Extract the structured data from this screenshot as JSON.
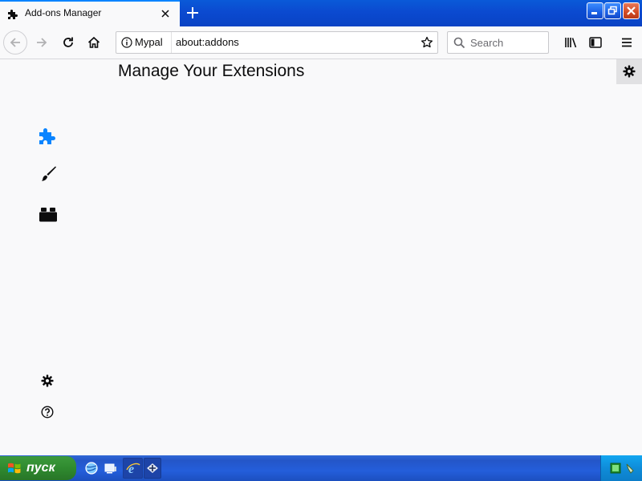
{
  "window": {
    "tab": {
      "title": "Add-ons Manager",
      "icon": "puzzle-icon"
    },
    "controls": [
      "minimize-icon",
      "restore-icon",
      "close-icon"
    ]
  },
  "navbar": {
    "identity_label": "Mypal",
    "url": "about:addons",
    "search_placeholder": "Search"
  },
  "content": {
    "heading": "Manage Your Extensions",
    "categories": [
      {
        "name": "extensions",
        "icon": "puzzle-icon",
        "color": "#0a84ff"
      },
      {
        "name": "themes",
        "icon": "brush-icon",
        "color": "#0c0c0d"
      },
      {
        "name": "plugins",
        "icon": "plugin-icon",
        "color": "#0c0c0d"
      }
    ],
    "footer": [
      "gear-icon",
      "help-icon"
    ]
  },
  "taskbar": {
    "start_label": "пуск"
  },
  "colors": {
    "accent": "#0a84ff",
    "titlebar": "#0b4ad0",
    "taskbar": "#245edb",
    "start": "#2f8a2f"
  }
}
